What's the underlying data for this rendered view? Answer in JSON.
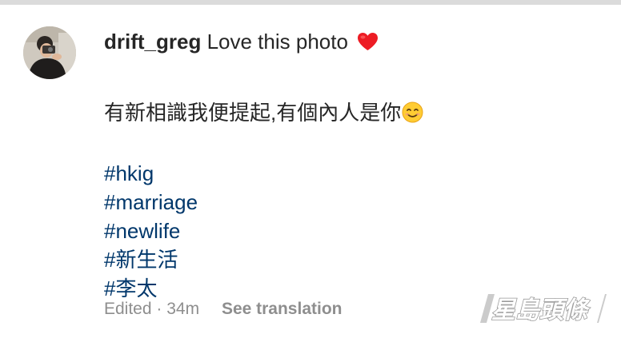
{
  "comment": {
    "username": "drift_greg",
    "headline_text": "Love this photo",
    "heart_icon": "red-heart-emoji",
    "caption": "有新相識我便提起,有個內人是你",
    "smile_icon": "smiling-face-emoji",
    "hashtags": [
      "#hkig",
      "#marriage",
      "#newlife",
      "#新生活",
      "#李太"
    ]
  },
  "meta": {
    "edited_label": "Edited",
    "separator": "·",
    "time_ago": "34m",
    "see_translation_label": "See translation"
  },
  "watermark": {
    "text": "星島頭條"
  },
  "colors": {
    "text": "#262626",
    "hashtag": "#00376b",
    "meta": "#8e8e8e",
    "heart": "#ed1c24",
    "divider": "#dbdbdb"
  }
}
